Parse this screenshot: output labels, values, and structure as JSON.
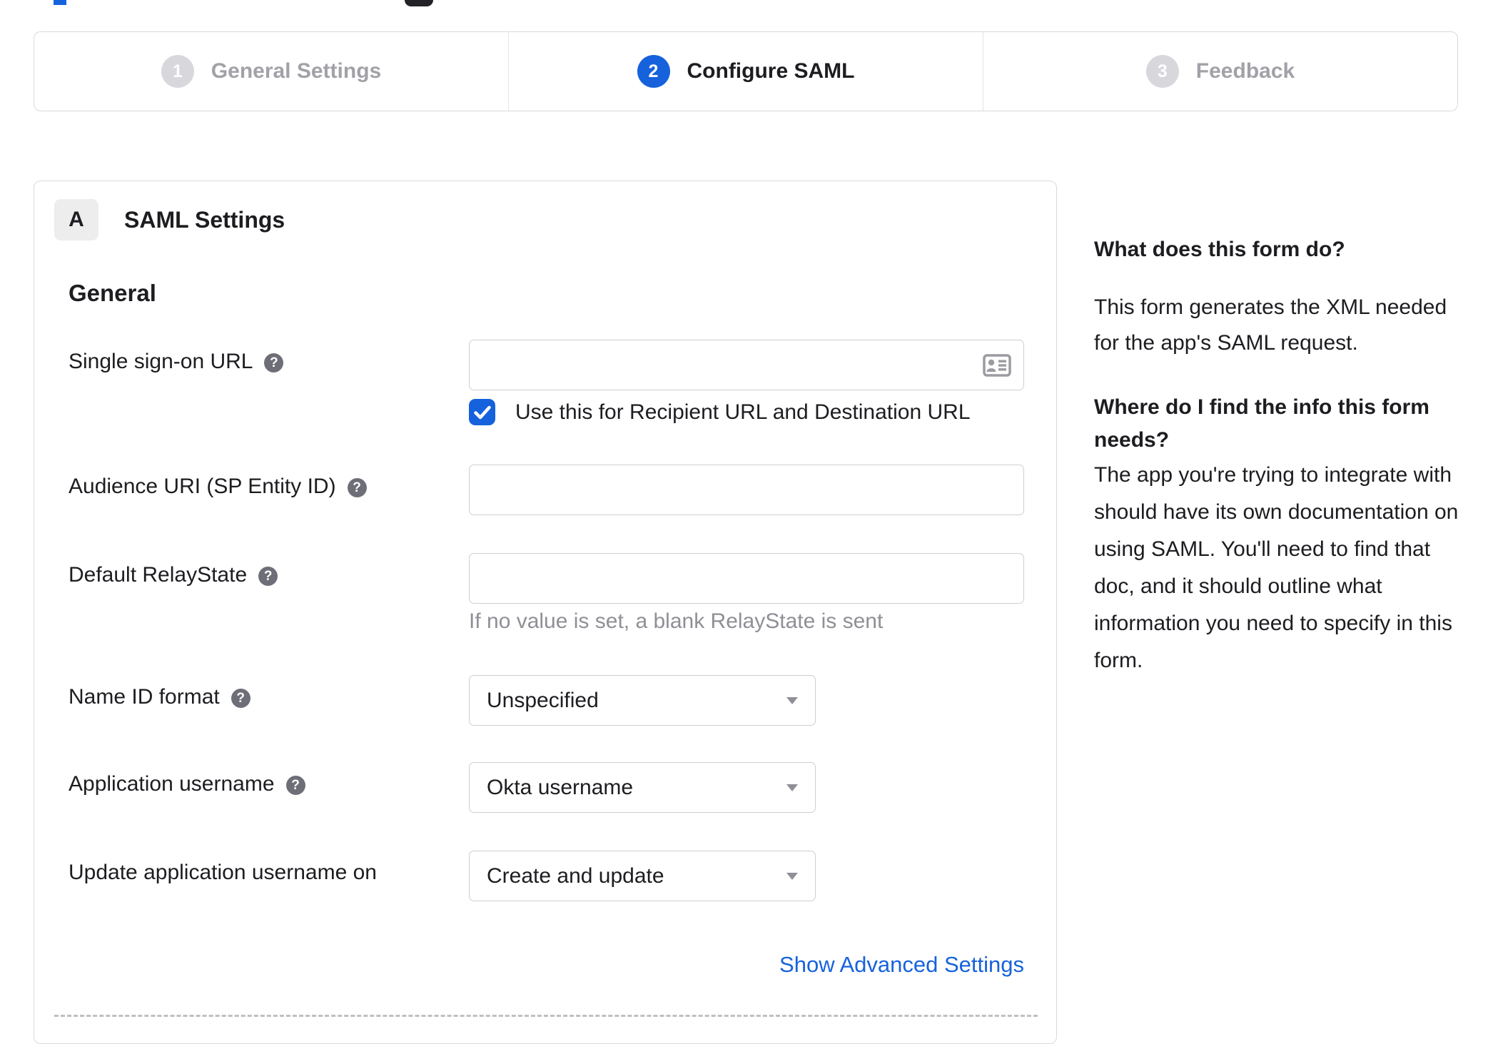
{
  "stepper": {
    "steps": [
      {
        "number": "1",
        "label": "General Settings",
        "active": false
      },
      {
        "number": "2",
        "label": "Configure SAML",
        "active": true
      },
      {
        "number": "3",
        "label": "Feedback",
        "active": false
      }
    ]
  },
  "form": {
    "badge": "A",
    "title": "SAML Settings",
    "section_heading": "General",
    "fields": {
      "sso": {
        "label": "Single sign-on URL",
        "value": "",
        "checkbox_label": "Use this for Recipient URL and Destination URL",
        "checked": true
      },
      "audience": {
        "label": "Audience URI (SP Entity ID)",
        "value": ""
      },
      "relay_state": {
        "label": "Default RelayState",
        "value": "",
        "hint": "If no value is set, a blank RelayState is sent"
      },
      "name_id_format": {
        "label": "Name ID format",
        "selected": "Unspecified"
      },
      "app_username": {
        "label": "Application username",
        "selected": "Okta username"
      },
      "update_username": {
        "label": "Update application username on",
        "selected": "Create and update"
      }
    },
    "advanced_link": "Show Advanced Settings"
  },
  "sidebar": {
    "heading1": "What does this form do?",
    "body1": "This form generates the XML needed for the app's SAML request.",
    "heading2": "Where do I find the info this form needs?",
    "body2": "The app you're trying to integrate with should have its own documentation on using SAML. You'll need to find that doc, and it should outline what information you need to specify in this form."
  },
  "icons": {
    "help_glyph": "?",
    "help": "question-mark-circle",
    "input_right": "contact-card",
    "select_caret": "chevron-down",
    "checkbox_mark": "checkmark"
  },
  "colors": {
    "accent": "#1662dd",
    "text": "#1d1d21",
    "muted_text": "#a1a1a8",
    "hint_text": "#8f8f96",
    "border": "#dadade",
    "inactive_circle": "#d8d8dc",
    "help_icon_bg": "#6e6e78"
  }
}
